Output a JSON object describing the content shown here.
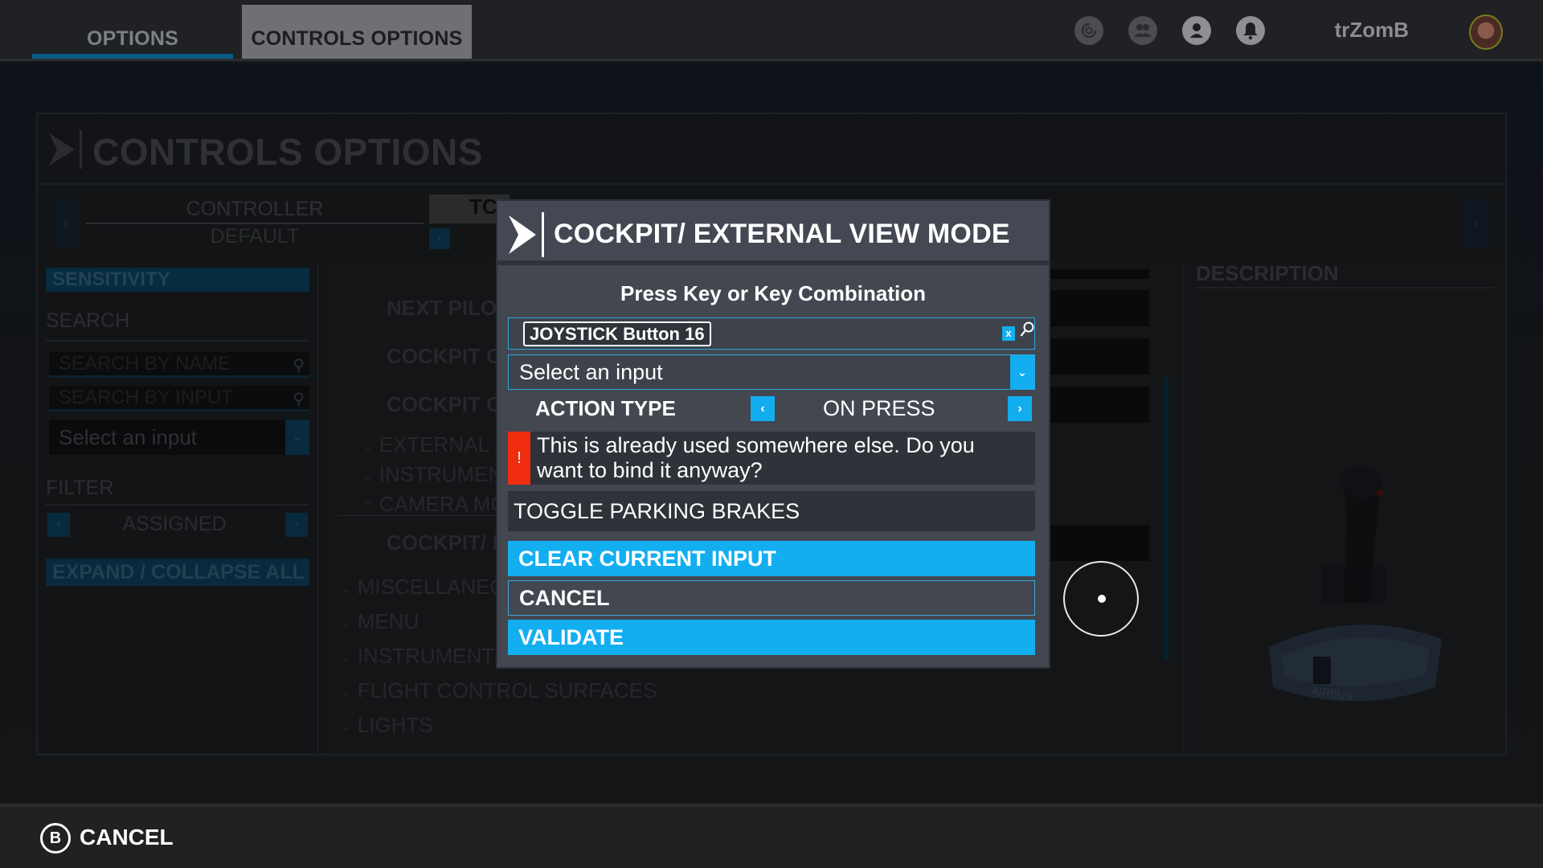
{
  "topbar": {
    "tabs": [
      {
        "label": "OPTIONS",
        "active": false
      },
      {
        "label": "CONTROLS OPTIONS",
        "active": true
      }
    ],
    "icons": [
      "activity-icon",
      "friends-icon",
      "profile-icon",
      "notifications-icon"
    ],
    "username": "trZomB"
  },
  "page": {
    "title": "CONTROLS OPTIONS",
    "controller": {
      "label": "CONTROLLER",
      "value": "DEFAULT",
      "device_tab": "TCA"
    }
  },
  "sidebar": {
    "sensitivity_label": "SENSITIVITY",
    "search_label": "SEARCH",
    "search_by_name_placeholder": "SEARCH BY NAME",
    "search_by_input_placeholder": "SEARCH BY INPUT",
    "select_input": "Select an input",
    "filter_label": "FILTER",
    "filter_value": "ASSIGNED",
    "expand_collapse_label": "EXPAND / COLLAPSE ALL"
  },
  "list": {
    "items": [
      {
        "label": "NEXT PILOT",
        "type": "binding"
      },
      {
        "label": "COCKPIT CAMERA",
        "type": "binding"
      },
      {
        "label": "COCKPIT CAMERA",
        "type": "binding"
      },
      {
        "label": "EXTERNAL",
        "type": "subcategory"
      },
      {
        "label": "INSTRUMENTS",
        "type": "subcategory"
      },
      {
        "label": "CAMERA MODE",
        "type": "subcategory-expanded"
      },
      {
        "label": "COCKPIT/ EXTERNAL VIEW MODE",
        "type": "binding"
      },
      {
        "label": "MISCELLANEOUS",
        "type": "category"
      },
      {
        "label": "MENU",
        "type": "category"
      },
      {
        "label": "INSTRUMENTS",
        "type": "category"
      },
      {
        "label": "FLIGHT CONTROL SURFACES",
        "type": "category"
      },
      {
        "label": "LIGHTS",
        "type": "category"
      }
    ]
  },
  "description": {
    "title": "DESCRIPTION",
    "device_brand": "AIRBUS"
  },
  "modal": {
    "title": "COCKPIT/ EXTERNAL VIEW MODE",
    "prompt": "Press Key or Key Combination",
    "current_key": "JOYSTICK Button 16",
    "select_input": "Select an input",
    "action_type_label": "ACTION TYPE",
    "action_type_value": "ON PRESS",
    "warning_icon": "!",
    "warning_text": "This is already used somewhere else. Do you want to bind it anyway?",
    "conflict_binding": "TOGGLE PARKING BRAKES",
    "buttons": {
      "clear": "CLEAR CURRENT INPUT",
      "cancel": "CANCEL",
      "validate": "VALIDATE"
    }
  },
  "bottombar": {
    "button_glyph": "B",
    "cancel_label": "CANCEL"
  },
  "colors": {
    "accent": "#12aef0",
    "warning": "#f02d0e",
    "modal_bg": "#434750"
  }
}
